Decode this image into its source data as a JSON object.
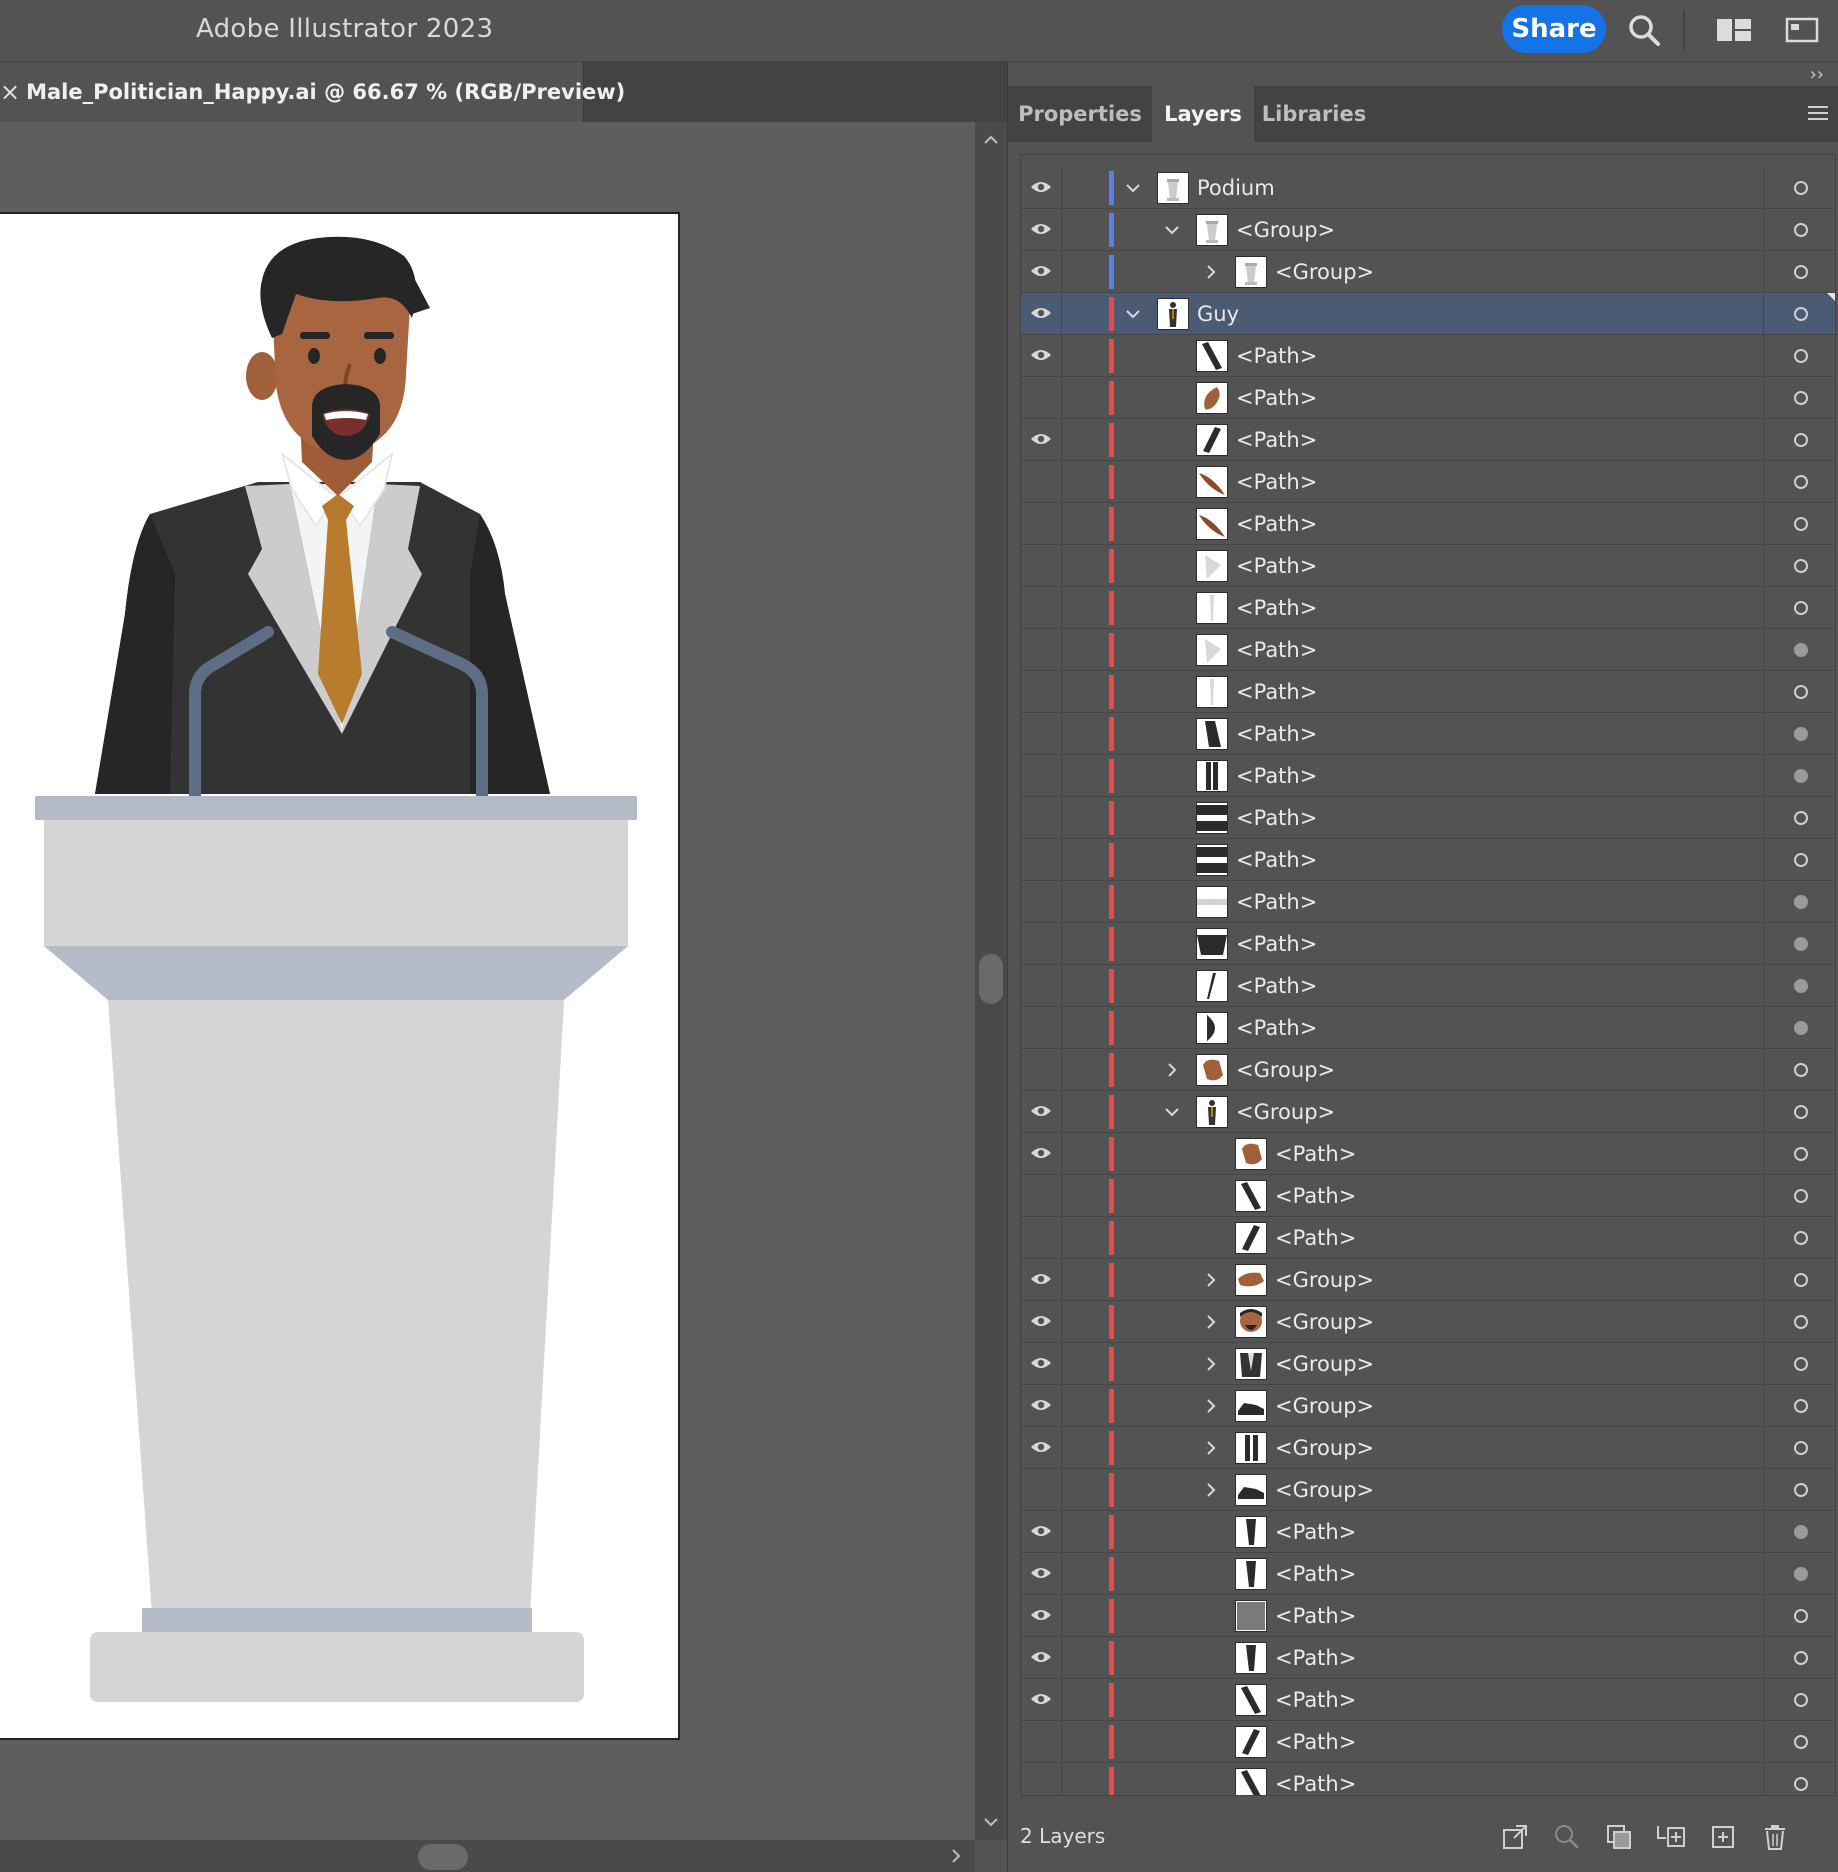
{
  "app": {
    "title": "Adobe Illustrator 2023",
    "share_label": "Share"
  },
  "document": {
    "tab_label": "Male_Politician_Happy.ai @ 66.67 % (RGB/Preview)",
    "close_glyph": "×"
  },
  "panel": {
    "collapse_glyph": "››",
    "tabs": [
      {
        "label": "Properties",
        "active": false
      },
      {
        "label": "Layers",
        "active": true
      },
      {
        "label": "Libraries",
        "active": false
      }
    ],
    "footer": {
      "layer_count": "2 Layers",
      "icons": [
        "export-for-screens-icon",
        "locate-object-icon",
        "make-clipping-mask-icon",
        "create-sublayer-icon",
        "create-new-layer-icon",
        "delete-icon"
      ]
    }
  },
  "colors": {
    "accent": "#1473e6",
    "podium_layer": "#5b7fe6",
    "guy_layer": "#e84a4a",
    "selection": "#4b5b73"
  },
  "layers": [
    {
      "name": "Podium",
      "depth": 0,
      "toggle": "open",
      "visible": true,
      "color": "podium",
      "thumb": "podium",
      "target": "empty"
    },
    {
      "name": "<Group>",
      "depth": 1,
      "toggle": "open",
      "visible": true,
      "color": "podium",
      "thumb": "podium",
      "target": "empty"
    },
    {
      "name": "<Group>",
      "depth": 2,
      "toggle": "closed",
      "visible": true,
      "color": "podium",
      "thumb": "podium",
      "target": "empty"
    },
    {
      "name": "Guy",
      "depth": 0,
      "toggle": "open",
      "visible": true,
      "color": "guy",
      "thumb": "figure",
      "target": "empty",
      "selected": true
    },
    {
      "name": "<Path>",
      "depth": 1,
      "toggle": "none",
      "visible": true,
      "color": "guy",
      "thumb": "stripe-down",
      "target": "empty"
    },
    {
      "name": "<Path>",
      "depth": 1,
      "toggle": "none",
      "visible": false,
      "color": "guy",
      "thumb": "skin-blob",
      "target": "empty"
    },
    {
      "name": "<Path>",
      "depth": 1,
      "toggle": "none",
      "visible": true,
      "color": "guy",
      "thumb": "stripe-up",
      "target": "empty"
    },
    {
      "name": "<Path>",
      "depth": 1,
      "toggle": "none",
      "visible": false,
      "color": "guy",
      "thumb": "skin-diag",
      "target": "empty"
    },
    {
      "name": "<Path>",
      "depth": 1,
      "toggle": "none",
      "visible": false,
      "color": "guy",
      "thumb": "skin-diag",
      "target": "empty"
    },
    {
      "name": "<Path>",
      "depth": 1,
      "toggle": "none",
      "visible": false,
      "color": "guy",
      "thumb": "light-shape",
      "target": "empty"
    },
    {
      "name": "<Path>",
      "depth": 1,
      "toggle": "none",
      "visible": false,
      "color": "guy",
      "thumb": "light-thin",
      "target": "empty"
    },
    {
      "name": "<Path>",
      "depth": 1,
      "toggle": "none",
      "visible": false,
      "color": "guy",
      "thumb": "light-shape",
      "target": "filled"
    },
    {
      "name": "<Path>",
      "depth": 1,
      "toggle": "none",
      "visible": false,
      "color": "guy",
      "thumb": "light-thin",
      "target": "empty"
    },
    {
      "name": "<Path>",
      "depth": 1,
      "toggle": "none",
      "visible": false,
      "color": "guy",
      "thumb": "dark-sleeve",
      "target": "filled"
    },
    {
      "name": "<Path>",
      "depth": 1,
      "toggle": "none",
      "visible": false,
      "color": "guy",
      "thumb": "dark-bar",
      "target": "filled"
    },
    {
      "name": "<Path>",
      "depth": 1,
      "toggle": "none",
      "visible": false,
      "color": "guy",
      "thumb": "h-band",
      "target": "empty"
    },
    {
      "name": "<Path>",
      "depth": 1,
      "toggle": "none",
      "visible": false,
      "color": "guy",
      "thumb": "h-band",
      "target": "empty"
    },
    {
      "name": "<Path>",
      "depth": 1,
      "toggle": "none",
      "visible": false,
      "color": "guy",
      "thumb": "grey-band",
      "target": "filled"
    },
    {
      "name": "<Path>",
      "depth": 1,
      "toggle": "none",
      "visible": false,
      "color": "guy",
      "thumb": "dark-bowl",
      "target": "filled"
    },
    {
      "name": "<Path>",
      "depth": 1,
      "toggle": "none",
      "visible": false,
      "color": "guy",
      "thumb": "thin-dark",
      "target": "filled"
    },
    {
      "name": "<Path>",
      "depth": 1,
      "toggle": "none",
      "visible": false,
      "color": "guy",
      "thumb": "half-moon",
      "target": "filled"
    },
    {
      "name": "<Group>",
      "depth": 1,
      "toggle": "closed",
      "visible": false,
      "color": "guy",
      "thumb": "hand",
      "target": "empty"
    },
    {
      "name": "<Group>",
      "depth": 1,
      "toggle": "open",
      "visible": true,
      "color": "guy",
      "thumb": "figure",
      "target": "empty"
    },
    {
      "name": "<Path>",
      "depth": 2,
      "toggle": "none",
      "visible": true,
      "color": "guy",
      "thumb": "hand",
      "target": "empty"
    },
    {
      "name": "<Path>",
      "depth": 2,
      "toggle": "none",
      "visible": false,
      "color": "guy",
      "thumb": "stripe-down",
      "target": "empty"
    },
    {
      "name": "<Path>",
      "depth": 2,
      "toggle": "none",
      "visible": false,
      "color": "guy",
      "thumb": "stripe-up",
      "target": "empty"
    },
    {
      "name": "<Group>",
      "depth": 2,
      "toggle": "closed",
      "visible": true,
      "color": "guy",
      "thumb": "hand-side",
      "target": "empty"
    },
    {
      "name": "<Group>",
      "depth": 2,
      "toggle": "closed",
      "visible": true,
      "color": "guy",
      "thumb": "head",
      "target": "empty"
    },
    {
      "name": "<Group>",
      "depth": 2,
      "toggle": "closed",
      "visible": true,
      "color": "guy",
      "thumb": "suit",
      "target": "empty"
    },
    {
      "name": "<Group>",
      "depth": 2,
      "toggle": "closed",
      "visible": true,
      "color": "guy",
      "thumb": "shoe",
      "target": "empty"
    },
    {
      "name": "<Group>",
      "depth": 2,
      "toggle": "closed",
      "visible": true,
      "color": "guy",
      "thumb": "legs",
      "target": "empty"
    },
    {
      "name": "<Group>",
      "depth": 2,
      "toggle": "closed",
      "visible": false,
      "color": "guy",
      "thumb": "shoe",
      "target": "empty"
    },
    {
      "name": "<Path>",
      "depth": 2,
      "toggle": "none",
      "visible": true,
      "color": "guy",
      "thumb": "leg",
      "target": "filled"
    },
    {
      "name": "<Path>",
      "depth": 2,
      "toggle": "none",
      "visible": true,
      "color": "guy",
      "thumb": "leg",
      "target": "filled"
    },
    {
      "name": "<Path>",
      "depth": 2,
      "toggle": "none",
      "visible": true,
      "color": "guy",
      "thumb": "grey-square",
      "target": "empty"
    },
    {
      "name": "<Path>",
      "depth": 2,
      "toggle": "none",
      "visible": true,
      "color": "guy",
      "thumb": "leg",
      "target": "empty"
    },
    {
      "name": "<Path>",
      "depth": 2,
      "toggle": "none",
      "visible": true,
      "color": "guy",
      "thumb": "stripe-down",
      "target": "empty"
    },
    {
      "name": "<Path>",
      "depth": 2,
      "toggle": "none",
      "visible": false,
      "color": "guy",
      "thumb": "stripe-up",
      "target": "empty"
    },
    {
      "name": "<Path>",
      "depth": 2,
      "toggle": "none",
      "visible": false,
      "color": "guy",
      "thumb": "stripe-down",
      "target": "empty"
    }
  ]
}
